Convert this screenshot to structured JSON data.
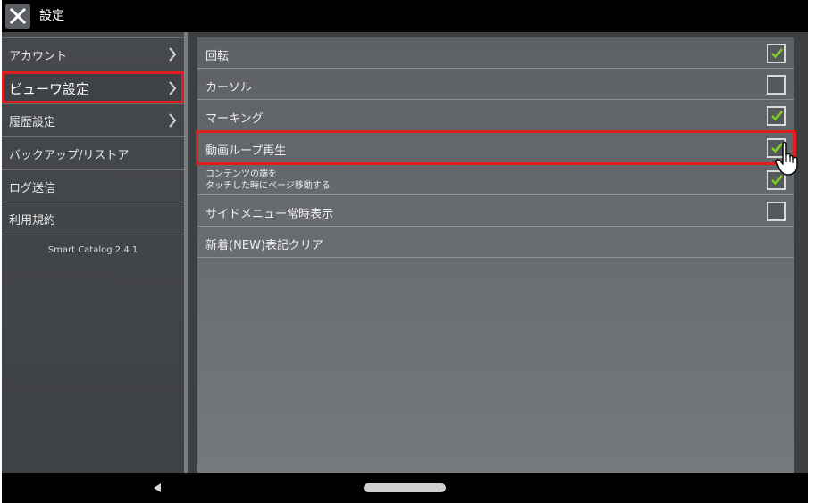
{
  "header": {
    "title": "設定",
    "close_icon": "close-icon"
  },
  "sidebar": {
    "items": [
      {
        "label": "アカウント",
        "has_chevron": true,
        "selected": false
      },
      {
        "label": "ビューワ設定",
        "has_chevron": true,
        "selected": true
      },
      {
        "label": "履歴設定",
        "has_chevron": true,
        "selected": false
      },
      {
        "label": "バックアップ/リストア",
        "has_chevron": false,
        "selected": false
      },
      {
        "label": "ログ送信",
        "has_chevron": false,
        "selected": false
      },
      {
        "label": "利用規約",
        "has_chevron": false,
        "selected": false
      }
    ],
    "version": "Smart Catalog 2.4.1"
  },
  "settings": {
    "rows": [
      {
        "label": "回転",
        "checked": true
      },
      {
        "label": "カーソル",
        "checked": false
      },
      {
        "label": "マーキング",
        "checked": true
      },
      {
        "label": "動画ループ再生",
        "checked": true,
        "highlighted": true
      },
      {
        "label_line1": "コンテンツの端を",
        "label_line2": "タッチした時にページ移動する",
        "checked": true
      },
      {
        "label": "サイドメニュー常時表示",
        "checked": false
      },
      {
        "label": "新着(NEW)表記クリア"
      }
    ]
  },
  "colors": {
    "highlight": "#e01e1e",
    "check": "#7ed321"
  },
  "navbar": {
    "back_icon": "back-triangle-icon",
    "home_icon": "home-pill-icon"
  }
}
